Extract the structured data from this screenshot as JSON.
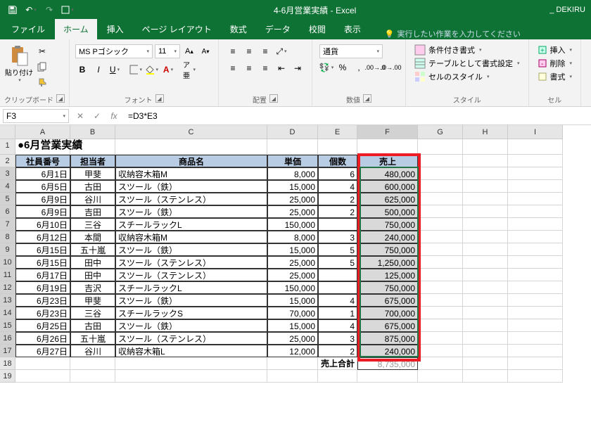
{
  "title": "4-6月営業実績 - Excel",
  "user": "_ DEKIRU",
  "tabs": [
    "ファイル",
    "ホーム",
    "挿入",
    "ページ レイアウト",
    "数式",
    "データ",
    "校閲",
    "表示"
  ],
  "active_tab": "ホーム",
  "tell_me": "実行したい作業を入力してください",
  "font": {
    "name": "MS Pゴシック",
    "size": "11"
  },
  "number_format": "通貨",
  "groups": {
    "clipboard": "クリップボード",
    "font": "フォント",
    "alignment": "配置",
    "number": "数値",
    "styles": "スタイル",
    "cells": "セル"
  },
  "paste": "貼り付け",
  "styles": {
    "conditional": "条件付き書式",
    "table": "テーブルとして書式設定",
    "cell": "セルのスタイル"
  },
  "cells": {
    "insert": "挿入",
    "delete": "削除",
    "format": "書式"
  },
  "namebox": "F3",
  "formula": "=D3*E3",
  "sheet_title": "●6月営業実績",
  "headers": [
    "社員番号",
    "担当者",
    "商品名",
    "単価",
    "個数",
    "売上"
  ],
  "total_label": "売上合計",
  "cols": [
    "A",
    "B",
    "C",
    "D",
    "E",
    "F",
    "G",
    "H",
    "I"
  ],
  "rows": [
    {
      "a": "6月1日",
      "b": "甲斐",
      "c": "収納容木箱M",
      "d": "8,000",
      "e": "6",
      "f": "480,000"
    },
    {
      "a": "6月5日",
      "b": "古田",
      "c": "スツール（鉄）",
      "d": "15,000",
      "e": "4",
      "f": "600,000"
    },
    {
      "a": "6月9日",
      "b": "谷川",
      "c": "スツール（ステンレス）",
      "d": "25,000",
      "e": "2",
      "f": "625,000"
    },
    {
      "a": "6月9日",
      "b": "吉田",
      "c": "スツール（鉄）",
      "d": "25,000",
      "e": "2",
      "f": "500,000"
    },
    {
      "a": "6月10日",
      "b": "三谷",
      "c": "スチールラックL",
      "d": "150,000",
      "e": "",
      "f": "750,000"
    },
    {
      "a": "6月12日",
      "b": "本間",
      "c": "収納容木箱M",
      "d": "8,000",
      "e": "3",
      "f": "240,000"
    },
    {
      "a": "6月15日",
      "b": "五十嵐",
      "c": "スツール（鉄）",
      "d": "15,000",
      "e": "5",
      "f": "750,000"
    },
    {
      "a": "6月15日",
      "b": "田中",
      "c": "スツール（ステンレス）",
      "d": "25,000",
      "e": "5",
      "f": "1,250,000"
    },
    {
      "a": "6月17日",
      "b": "田中",
      "c": "スツール（ステンレス）",
      "d": "25,000",
      "e": "",
      "f": "125,000"
    },
    {
      "a": "6月19日",
      "b": "吉沢",
      "c": "スチールラックL",
      "d": "150,000",
      "e": "",
      "f": "750,000"
    },
    {
      "a": "6月23日",
      "b": "甲斐",
      "c": "スツール（鉄）",
      "d": "15,000",
      "e": "4",
      "f": "675,000"
    },
    {
      "a": "6月23日",
      "b": "三谷",
      "c": "スチールラックS",
      "d": "70,000",
      "e": "1",
      "f": "700,000"
    },
    {
      "a": "6月25日",
      "b": "古田",
      "c": "スツール（鉄）",
      "d": "15,000",
      "e": "4",
      "f": "675,000"
    },
    {
      "a": "6月26日",
      "b": "五十嵐",
      "c": "スツール（ステンレス）",
      "d": "25,000",
      "e": "3",
      "f": "875,000"
    },
    {
      "a": "6月27日",
      "b": "谷川",
      "c": "収納容木箱L",
      "d": "12,000",
      "e": "2",
      "f": "240,000"
    }
  ],
  "total": "8,735,000"
}
